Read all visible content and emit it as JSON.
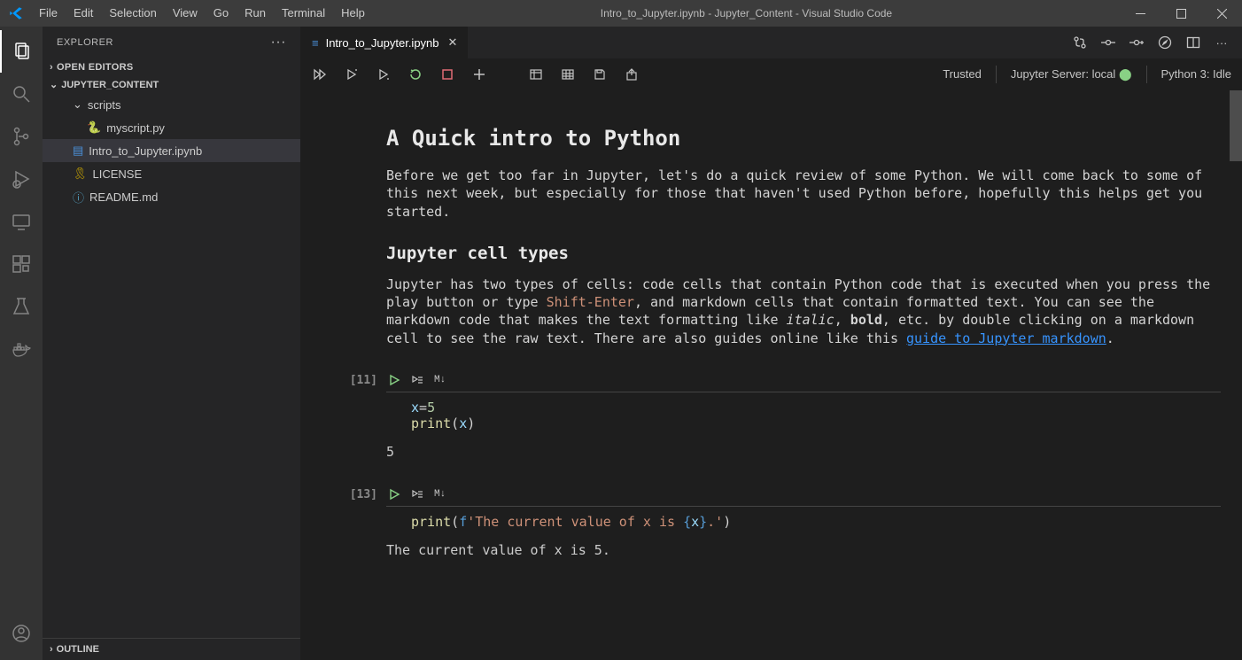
{
  "window": {
    "title": "Intro_to_Jupyter.ipynb - Jupyter_Content - Visual Studio Code"
  },
  "menu": [
    "File",
    "Edit",
    "Selection",
    "View",
    "Go",
    "Run",
    "Terminal",
    "Help"
  ],
  "explorer": {
    "title": "EXPLORER",
    "open_editors_label": "OPEN EDITORS",
    "folder_name": "JUPYTER_CONTENT",
    "tree": {
      "folder": "scripts",
      "items": [
        {
          "name": "myscript.py",
          "icon": "py"
        },
        {
          "name": "Intro_to_Jupyter.ipynb",
          "icon": "nb",
          "selected": true
        },
        {
          "name": "LICENSE",
          "icon": "lic"
        },
        {
          "name": "README.md",
          "icon": "md"
        }
      ]
    },
    "outline_label": "OUTLINE"
  },
  "editor": {
    "tab": {
      "filename": "Intro_to_Jupyter.ipynb"
    },
    "nb_status": {
      "trusted": "Trusted",
      "server": "Jupyter Server: local",
      "kernel": "Python 3: Idle"
    }
  },
  "notebook": {
    "md": {
      "h1": "A Quick intro to Python",
      "p1": "Before we get too far in Jupyter, let's do a quick review of some Python. We will come back to some of this next week, but especially for those that haven't used Python before, hopefully this helps get you started.",
      "h2": "Jupyter cell types",
      "p2a": "Jupyter has two types of cells: code cells that contain Python code that is executed when you press the play button or type ",
      "p2code": "Shift-Enter",
      "p2b": ", and markdown cells that contain formatted text. You can see the markdown code that makes the text formatting like ",
      "p2italic": "italic",
      "p2c": ", ",
      "p2bold": "bold",
      "p2d": ", etc. by double clicking on a markdown cell to see the raw text. There are also guides online like this ",
      "p2link": "guide to Jupyter markdown",
      "p2e": "."
    },
    "cells": [
      {
        "exec": "[11]",
        "mdlabel": "M↓",
        "code_lines": [
          "x=5",
          "print(x)"
        ],
        "output": "5"
      },
      {
        "exec": "[13]",
        "mdlabel": "M↓",
        "code_fstring": {
          "prefix": "print(",
          "f": "f",
          "s1": "'The current value of x is ",
          "braceopen": "{",
          "var": "x",
          "braceclose": "}",
          "s2": ".'",
          "suffix": ")"
        },
        "output": "The current value of x is 5."
      }
    ]
  }
}
